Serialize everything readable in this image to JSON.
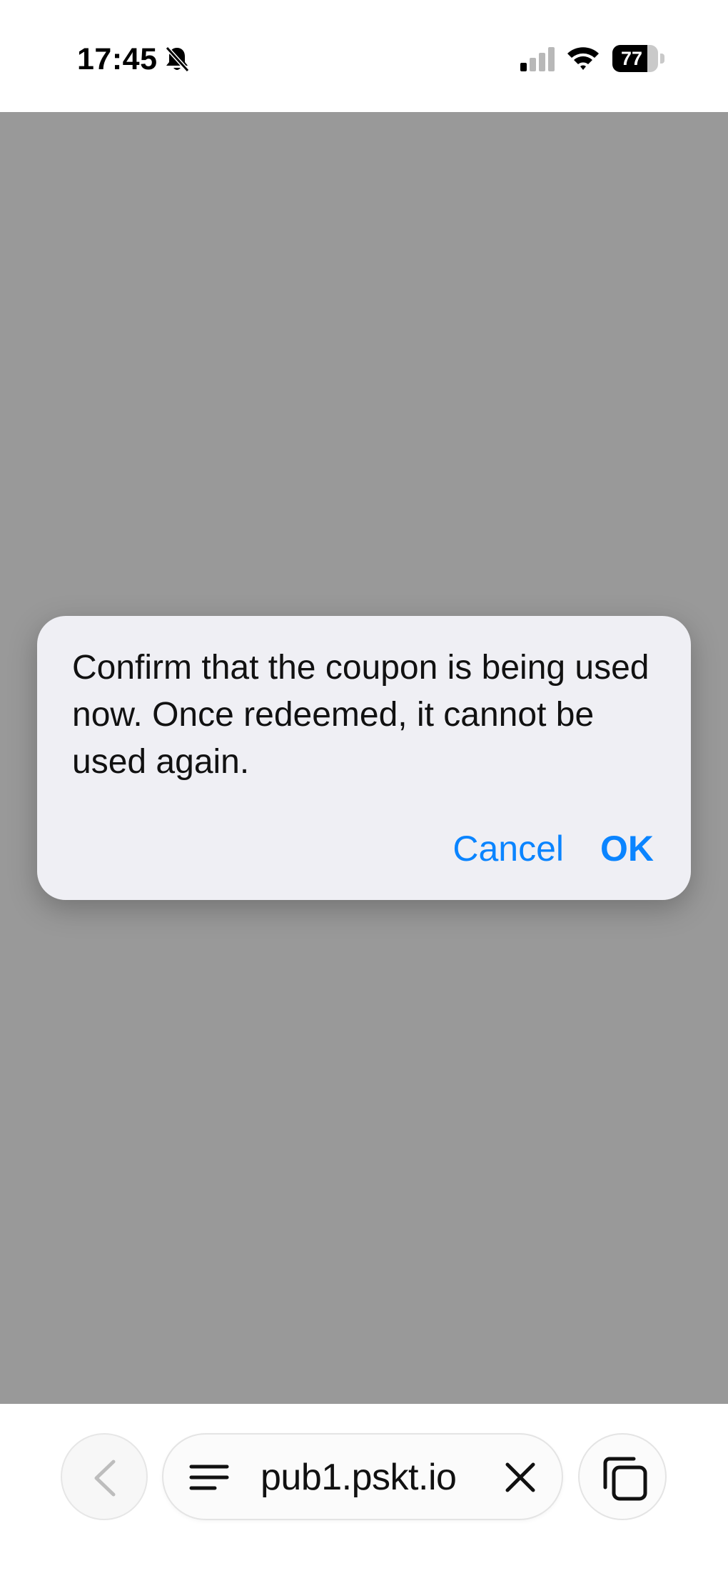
{
  "status_bar": {
    "time": "17:45",
    "battery_level": "77",
    "battery_fraction": 0.77,
    "icons": [
      "bell-slash-icon",
      "cellular-signal-icon",
      "wifi-icon",
      "battery-icon"
    ]
  },
  "alert": {
    "message": "Confirm that the coupon is being used now. Once redeemed, it cannot be used again.",
    "cancel_label": "Cancel",
    "ok_label": "OK"
  },
  "toolbar": {
    "url": "pub1.pskt.io",
    "icons": [
      "chevron-left-icon",
      "menu-icon",
      "close-icon",
      "tabs-icon"
    ]
  },
  "colors": {
    "accent": "#0a84ff",
    "overlay": "#999999",
    "dialog_background": "#efeff4"
  }
}
